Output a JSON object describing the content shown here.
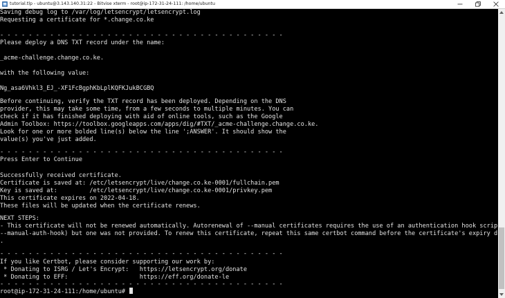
{
  "window": {
    "title": "tutorial.tlp - ubuntu@3.143.140.31:22 - Bitvise xterm - root@ip-172-31-24-111: /home/ubuntu",
    "minimize_icon": "minimize-icon",
    "maximize_icon": "maximize-icon",
    "close_icon": "close-icon"
  },
  "terminal": {
    "lines": [
      "Saving debug log to /var/log/letsencrypt/letsencrypt.log",
      "Requesting a certificate for *.change.co.ke",
      "",
      "- - - - - - - - - - - - - - - - - - - - - - - - - - - - - - - - - - - - - - - -",
      "Please deploy a DNS TXT record under the name:",
      "",
      "_acme-challenge.change.co.ke.",
      "",
      "with the following value:",
      "",
      "Ng_asa6Vhkl3_EJ_-XF1FcBgphKbLplKQFKJukBCGBQ",
      "",
      "Before continuing, verify the TXT record has been deployed. Depending on the DNS",
      "provider, this may take some time, from a few seconds to multiple minutes. You can",
      "check if it has finished deploying with aid of online tools, such as the Google",
      "Admin Toolbox: https://toolbox.googleapps.com/apps/dig/#TXT/_acme-challenge.change.co.ke.",
      "Look for one or more bolded line(s) below the line ';ANSWER'. It should show the",
      "value(s) you've just added.",
      "",
      "- - - - - - - - - - - - - - - - - - - - - - - - - - - - - - - - - - - - - - - -",
      "Press Enter to Continue",
      "",
      "Successfully received certificate.",
      "Certificate is saved at: /etc/letsencrypt/live/change.co.ke-0001/fullchain.pem",
      "Key is saved at:         /etc/letsencrypt/live/change.co.ke-0001/privkey.pem",
      "This certificate expires on 2022-04-18.",
      "These files will be updated when the certificate renews.",
      "",
      "NEXT STEPS:",
      "- This certificate will not be renewed automatically. Autorenewal of --manual certificates requires the use of an authentication hook script (",
      "--manual-auth-hook) but one was not provided. To renew this certificate, repeat this same certbot command before the certificate's expiry date",
      ".",
      "",
      "- - - - - - - - - - - - - - - - - - - - - - - - - - - - - - - - - - - - - - - -",
      "If you like Certbot, please consider supporting our work by:",
      " * Donating to ISRG / Let's Encrypt:   https://letsencrypt.org/donate",
      " * Donating to EFF:                    https://eff.org/donate-le",
      "- - - - - - - - - - - - - - - - - - - - - - - - - - - - - - - - - - - - - - - -"
    ],
    "prompt": "root@ip-172-31-24-111:/home/ubuntu#"
  },
  "scrollbar": {
    "up_icon": "scroll-up-arrow-icon",
    "down_icon": "scroll-down-arrow-icon"
  }
}
